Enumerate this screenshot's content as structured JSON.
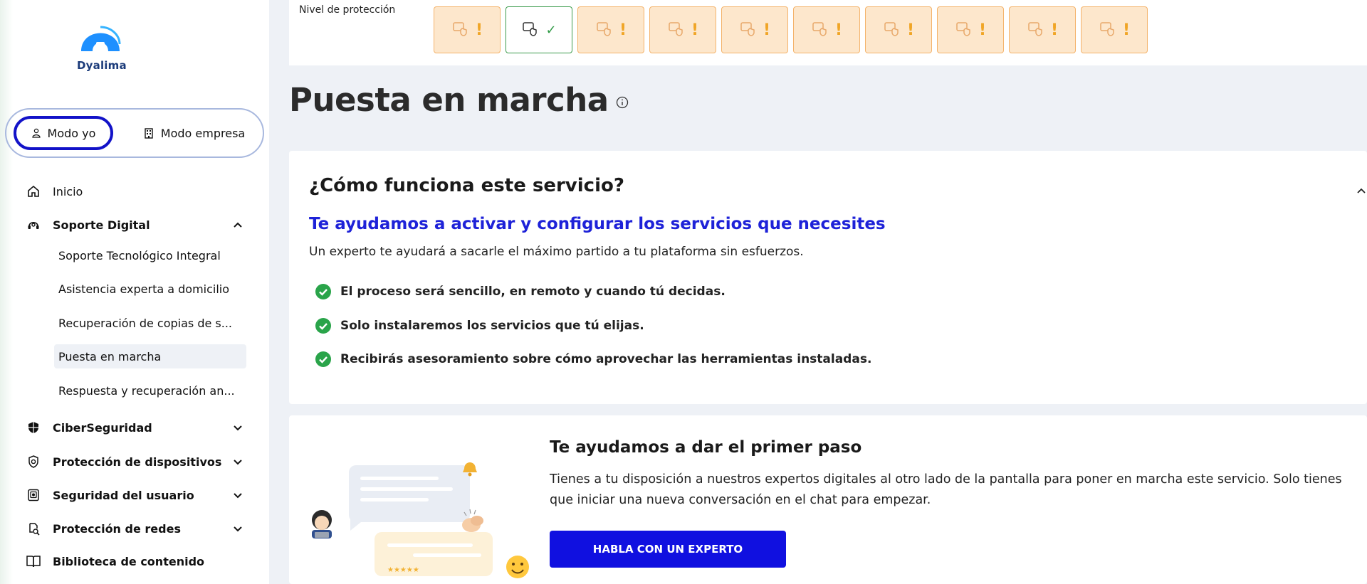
{
  "brand": {
    "name": "Dyalima",
    "accent": "#1010e0",
    "logo_color": "#1e90ff"
  },
  "mode_switch": {
    "personal_label": "Modo yo",
    "business_label": "Modo empresa",
    "selected": "Modo yo"
  },
  "sidebar": {
    "items": [
      {
        "label": "Inicio",
        "icon": "home-icon"
      },
      {
        "label": "Soporte Digital",
        "icon": "support-icon",
        "expanded": true,
        "children": [
          {
            "label": "Soporte Tecnológico Integral"
          },
          {
            "label": "Asistencia experta a domicilio"
          },
          {
            "label": "Recuperación de copias de s..."
          },
          {
            "label": "Puesta en marcha",
            "active": true
          },
          {
            "label": "Respuesta y recuperación an..."
          }
        ]
      },
      {
        "label": "CiberSeguridad",
        "icon": "shield-icon",
        "expanded": false
      },
      {
        "label": "Protección de dispositivos",
        "icon": "device-shield-icon",
        "expanded": false
      },
      {
        "label": "Seguridad del usuario",
        "icon": "user-security-icon",
        "expanded": false
      },
      {
        "label": "Protección de redes",
        "icon": "network-protection-icon",
        "expanded": false
      },
      {
        "label": "Biblioteca de contenido",
        "icon": "book-icon"
      }
    ]
  },
  "protection": {
    "label": "Nivel de protección",
    "items": [
      {
        "icon": "speed-shield-icon",
        "status": "warning",
        "mark": "!"
      },
      {
        "icon": "id-card-shield-icon",
        "status": "ok",
        "mark": "✓"
      },
      {
        "icon": "cloud-shield-icon",
        "status": "warning",
        "mark": "!"
      },
      {
        "icon": "document-lock-icon",
        "status": "warning",
        "mark": "!"
      },
      {
        "icon": "hand-shield-icon",
        "status": "warning",
        "mark": "!"
      },
      {
        "icon": "file-shield-icon",
        "status": "warning",
        "mark": "!"
      },
      {
        "icon": "laptop-search-icon",
        "status": "warning",
        "mark": "!"
      },
      {
        "icon": "laptop-shield-icon",
        "status": "warning",
        "mark": "!"
      },
      {
        "icon": "router-shield-icon",
        "status": "warning",
        "mark": "!"
      },
      {
        "icon": "box-shield-icon",
        "status": "warning",
        "mark": "!"
      }
    ],
    "warning_color": "#f0a526",
    "ok_color": "#2f9a45"
  },
  "page": {
    "title": "Puesta en marcha"
  },
  "how_it_works": {
    "title": "¿Cómo funciona este servicio?",
    "subtitle": "Te ayudamos a activar y configurar los servicios que necesites",
    "description": "Un experto te ayudará a sacarle el máximo partido a tu plataforma sin esfuerzos.",
    "points": [
      "El proceso será sencillo, en remoto y cuando tú decidas.",
      "Solo instalaremos los servicios que tú elijas.",
      "Recibirás asesoramiento sobre cómo aprovechar las herramientas instaladas."
    ]
  },
  "expert": {
    "title": "Te ayudamos a dar el primer paso",
    "description": "Tienes a tu disposición a nuestros expertos digitales al otro lado de la pantalla para poner en marcha este servicio. Solo tienes que iniciar una nueva conversación en el chat para empezar.",
    "button_label": "HABLA CON UN EXPERTO"
  }
}
